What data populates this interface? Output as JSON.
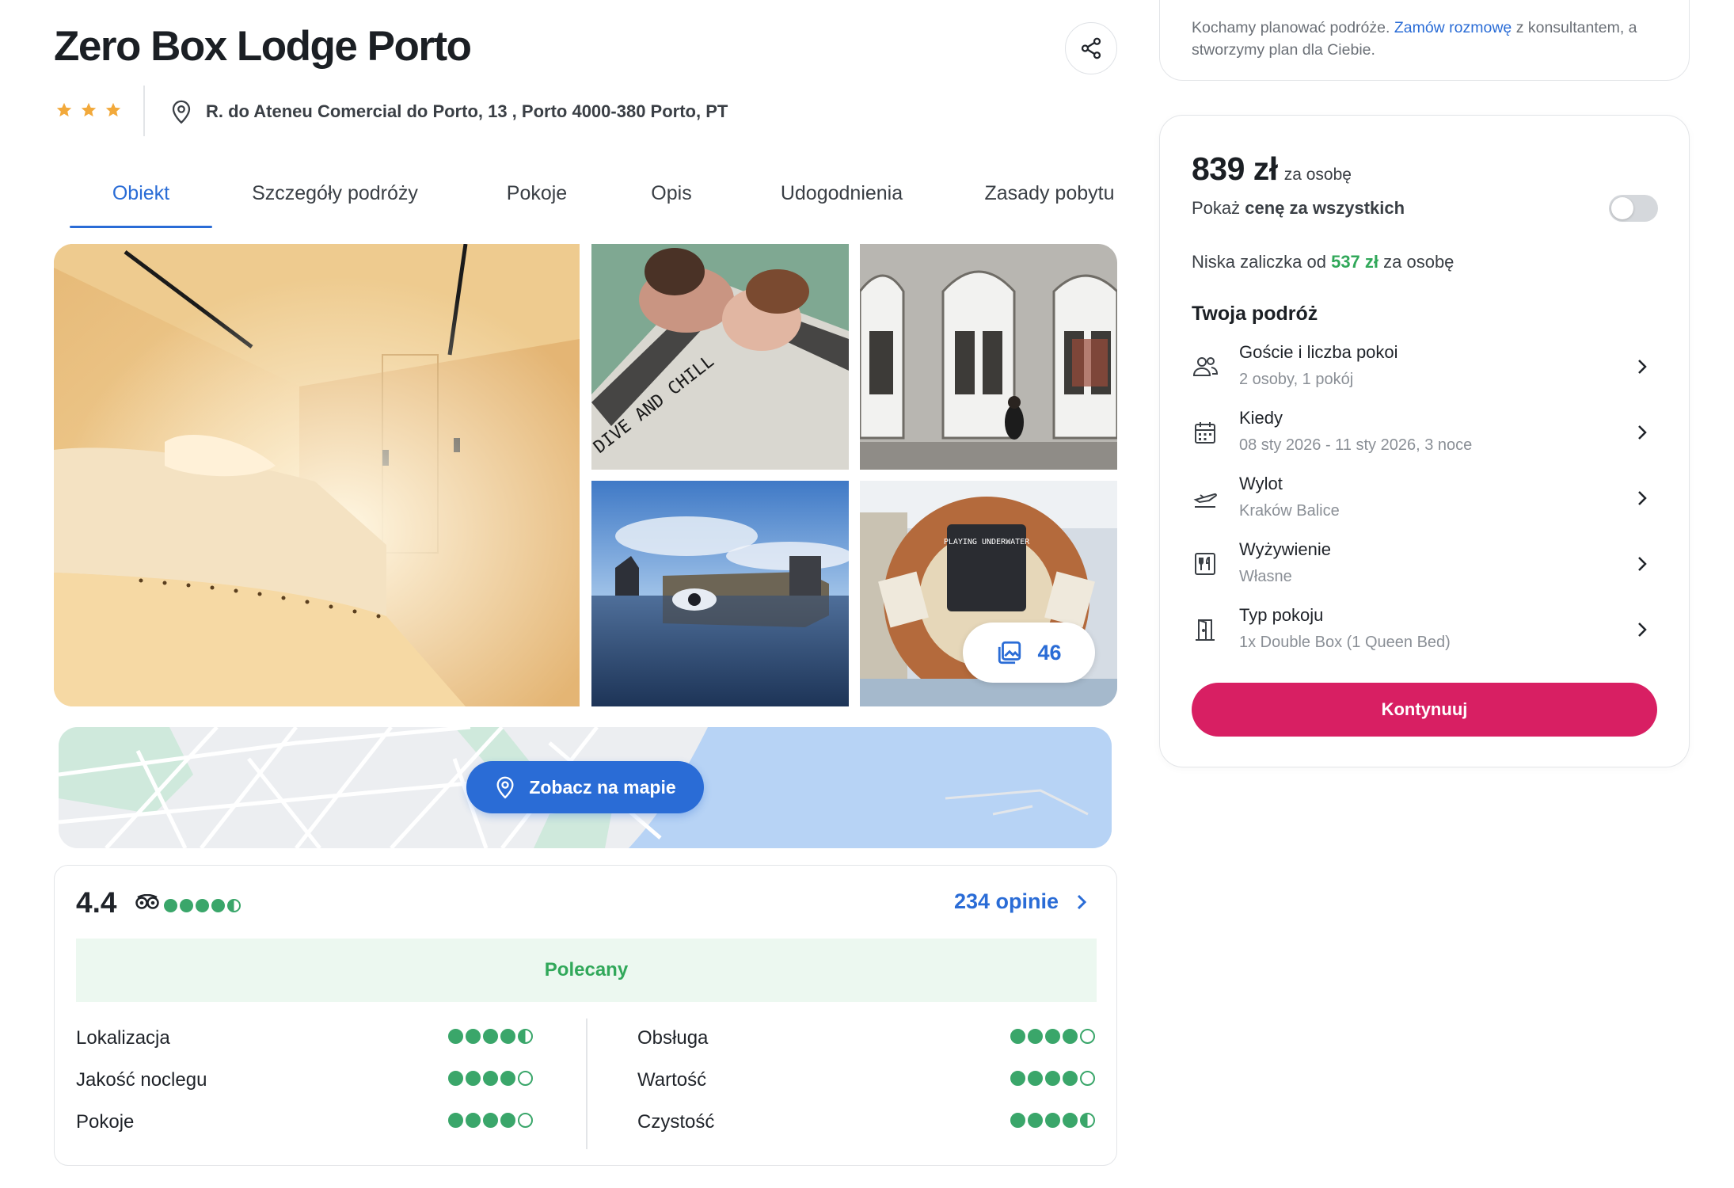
{
  "hotel": {
    "name": "Zero Box Lodge Porto",
    "stars": 3,
    "address": "R. do Ateneu Comercial do Porto, 13 , Porto 4000-380 Porto, PT"
  },
  "tabs": [
    {
      "label": "Obiekt",
      "active": true
    },
    {
      "label": "Szczegóły podróży"
    },
    {
      "label": "Pokoje"
    },
    {
      "label": "Opis"
    },
    {
      "label": "Udogodnienia"
    },
    {
      "label": "Zasady pobytu"
    }
  ],
  "gallery": {
    "photo_count": "46",
    "photo_texts": [
      "DIVE AND CHILL",
      "PLAYING UNDERWATER"
    ]
  },
  "map": {
    "button_label": "Zobacz na mapie"
  },
  "reviews": {
    "rating": "4.4",
    "overall_dots": 4.5,
    "count_label": "234 opinie",
    "recommendation": "Polecany",
    "categories": [
      {
        "label": "Lokalizacja",
        "score": 4.5
      },
      {
        "label": "Jakość noclegu",
        "score": 4
      },
      {
        "label": "Pokoje",
        "score": 4
      },
      {
        "label": "Obsługa",
        "score": 4
      },
      {
        "label": "Wartość",
        "score": 4
      },
      {
        "label": "Czystość",
        "score": 4.5
      }
    ]
  },
  "consult": {
    "text_before": "Kochamy planować podróże. ",
    "link": "Zamów rozmowę",
    "text_after": " z konsultantem, a stworzymy plan dla Ciebie."
  },
  "booking": {
    "price": "839 zł",
    "price_unit": "za osobę",
    "toggle_text_prefix": "Pokaż ",
    "toggle_text_bold": "cenę za wszystkich",
    "toggle_on": false,
    "deposit_prefix": "Niska zaliczka od ",
    "deposit_value": "537 zł",
    "deposit_suffix": " za osobę",
    "trip_title": "Twoja podróż",
    "items": [
      {
        "icon": "guests-icon",
        "label": "Goście i liczba pokoi",
        "value": "2 osoby, 1 pokój"
      },
      {
        "icon": "calendar-icon",
        "label": "Kiedy",
        "value": "08 sty 2026 - 11 sty 2026, 3 noce"
      },
      {
        "icon": "plane-icon",
        "label": "Wylot",
        "value": "Kraków Balice"
      },
      {
        "icon": "meal-icon",
        "label": "Wyżywienie",
        "value": "Własne"
      },
      {
        "icon": "door-icon",
        "label": "Typ pokoju",
        "value": "1x Double Box (1 Queen Bed)"
      }
    ],
    "cta_label": "Kontynuuj"
  },
  "colors": {
    "accent_blue": "#2a6cd6",
    "cta_pink": "#d81f63",
    "green": "#31a85a",
    "star": "#f2a93b"
  }
}
